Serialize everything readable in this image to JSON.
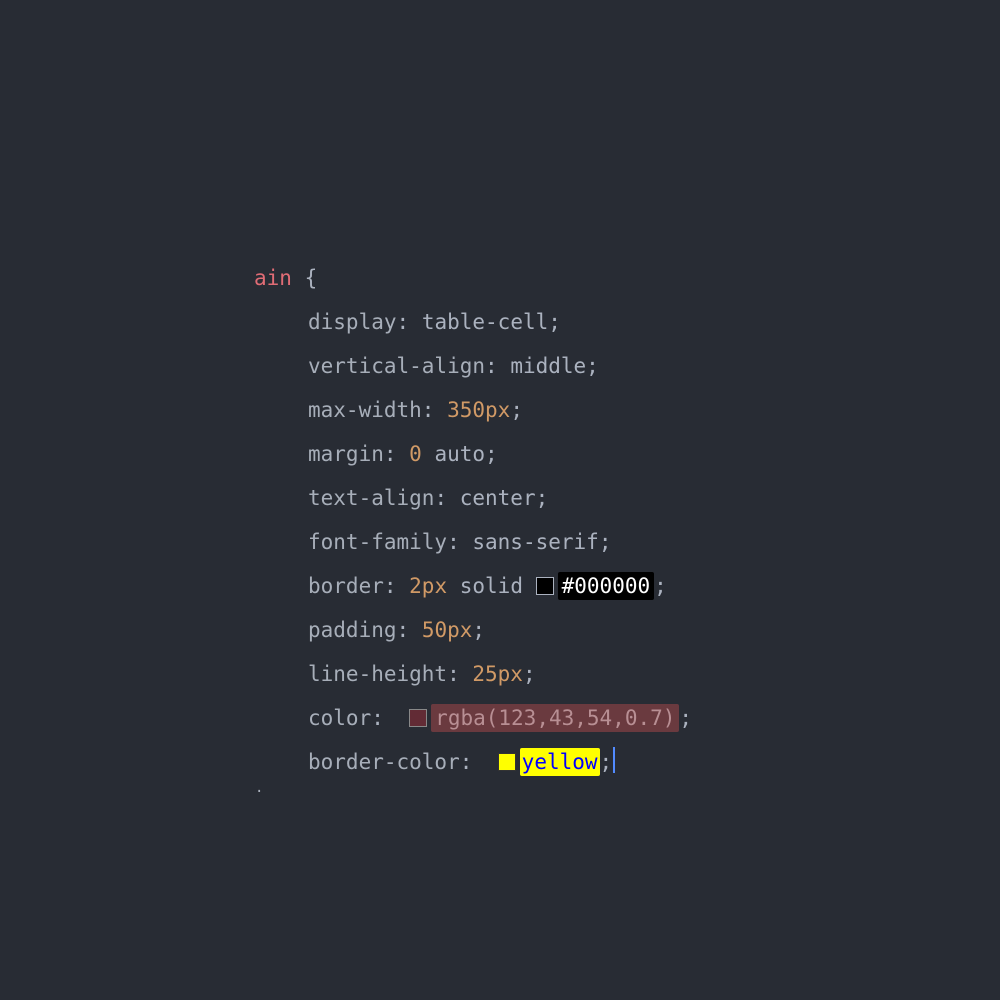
{
  "code": {
    "selector_fragment": "ain",
    "brace_open": " {",
    "brace_close": "}",
    "semicolon": ";",
    "colon_sp": ": ",
    "decls": [
      {
        "prop": "display",
        "parts": [
          {
            "t": "val",
            "v": "table-cell"
          }
        ]
      },
      {
        "prop": "vertical-align",
        "parts": [
          {
            "t": "val",
            "v": "middle"
          }
        ]
      },
      {
        "prop": "max-width",
        "parts": [
          {
            "t": "num",
            "v": "350px"
          }
        ]
      },
      {
        "prop": "margin",
        "parts": [
          {
            "t": "num",
            "v": "0"
          },
          {
            "t": "sp",
            "v": " "
          },
          {
            "t": "val",
            "v": "auto"
          }
        ]
      },
      {
        "prop": "text-align",
        "parts": [
          {
            "t": "val",
            "v": "center"
          }
        ]
      },
      {
        "prop": "font-family",
        "parts": [
          {
            "t": "val",
            "v": "sans-serif"
          }
        ]
      },
      {
        "prop": "border",
        "parts": [
          {
            "t": "num",
            "v": "2px"
          },
          {
            "t": "sp",
            "v": " "
          },
          {
            "t": "val",
            "v": "solid"
          },
          {
            "t": "sp",
            "v": " "
          },
          {
            "t": "swatch",
            "cls": "sw-black"
          },
          {
            "t": "pill",
            "cls": "pill-black",
            "v": "#000000"
          }
        ]
      },
      {
        "prop": "padding",
        "parts": [
          {
            "t": "num",
            "v": "50px"
          }
        ]
      },
      {
        "prop": "line-height",
        "parts": [
          {
            "t": "num",
            "v": "25px"
          }
        ]
      },
      {
        "prop": "color",
        "parts": [
          {
            "t": "sp",
            "v": " "
          },
          {
            "t": "swatch",
            "cls": "sw-rgba"
          },
          {
            "t": "pill",
            "cls": "pill-rgba",
            "v": "rgba(123,43,54,0.7)"
          }
        ]
      },
      {
        "prop": "border-color",
        "parts": [
          {
            "t": "sp",
            "v": " "
          },
          {
            "t": "swatch",
            "cls": "sw-yellow"
          },
          {
            "t": "pill",
            "cls": "pill-yellow",
            "v": "yellow"
          }
        ],
        "cursor_after": true
      }
    ]
  },
  "colors": {
    "bg": "#282c34",
    "fg": "#abb2bf",
    "selector": "#e06c75",
    "number": "#d19a66",
    "cursor": "#528bff"
  }
}
